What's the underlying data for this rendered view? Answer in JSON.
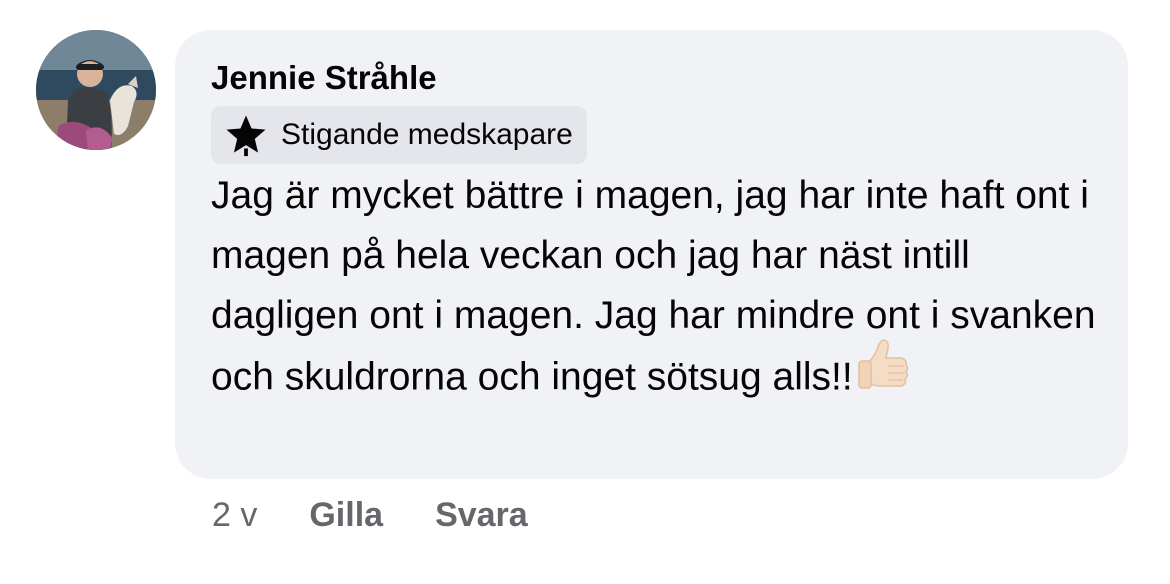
{
  "comment": {
    "author": "Jennie Stråhle",
    "badge": {
      "icon": "star-icon",
      "label": "Stigande medskapare"
    },
    "text": "Jag är mycket bättre i magen, jag har inte haft ont i magen på hela veckan och jag har näst intill dagligen ont i magen. Jag har mindre ont i svanken och skuldrorna och inget sötsug alls!!",
    "emoji": "thumbs-up-icon",
    "bubble_color": "#f0f2f5",
    "meta_color": "#65676b"
  },
  "actions": {
    "time": "2 v",
    "like_label": "Gilla",
    "reply_label": "Svara"
  }
}
